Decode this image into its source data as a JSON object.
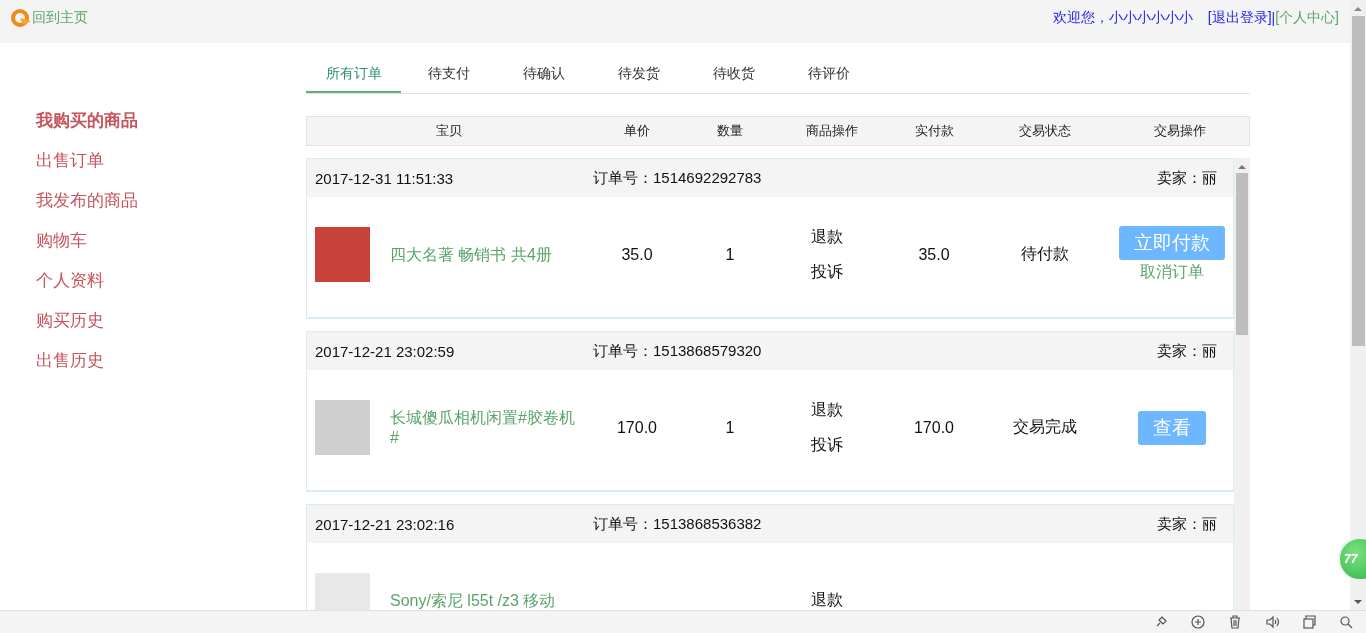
{
  "topbar": {
    "home_link": "回到主页",
    "welcome": "欢迎您，小小小小小小",
    "logout_link": "[退出登录]",
    "separator": "|",
    "profile_link": "[个人中心]"
  },
  "sidebar": {
    "items": [
      {
        "label": "我购买的商品",
        "selected": true
      },
      {
        "label": "出售订单",
        "selected": false
      },
      {
        "label": "我发布的商品",
        "selected": false
      },
      {
        "label": "购物车",
        "selected": false
      },
      {
        "label": "个人资料",
        "selected": false
      },
      {
        "label": "购买历史",
        "selected": false
      },
      {
        "label": "出售历史",
        "selected": false
      }
    ]
  },
  "tabs": [
    {
      "label": "所有订单",
      "selected": true
    },
    {
      "label": "待支付",
      "selected": false
    },
    {
      "label": "待确认",
      "selected": false
    },
    {
      "label": "待发货",
      "selected": false
    },
    {
      "label": "待收货",
      "selected": false
    },
    {
      "label": "待评价",
      "selected": false
    }
  ],
  "table": {
    "columns": [
      "宝贝",
      "单价",
      "数量",
      "商品操作",
      "实付款",
      "交易状态",
      "交易操作"
    ]
  },
  "orders": [
    {
      "time": "2017-12-31 11:51:33",
      "order_no": "订单号：1514692292783",
      "seller": "卖家：丽",
      "product": "四大名著 畅销书 共4册",
      "price": "35.0",
      "quantity": "1",
      "item_actions": [
        "退款",
        "投诉"
      ],
      "paid": "35.0",
      "status": "待付款",
      "actions": [
        {
          "kind": "button",
          "label": "立即付款"
        },
        {
          "kind": "link",
          "label": "取消订单"
        }
      ]
    },
    {
      "time": "2017-12-21 23:02:59",
      "order_no": "订单号：1513868579320",
      "seller": "卖家：丽",
      "product": "长城傻瓜相机闲置#胶卷机#",
      "price": "170.0",
      "quantity": "1",
      "item_actions": [
        "退款",
        "投诉"
      ],
      "paid": "170.0",
      "status": "交易完成",
      "actions": [
        {
          "kind": "button",
          "label": "查看"
        }
      ]
    },
    {
      "time": "2017-12-21 23:02:16",
      "order_no": "订单号：1513868536382",
      "seller": "卖家：丽",
      "product": "Sony/索尼 l55t /z3 移动",
      "item_actions": [
        "退款"
      ]
    }
  ],
  "floating_badge": {
    "label": "77"
  }
}
